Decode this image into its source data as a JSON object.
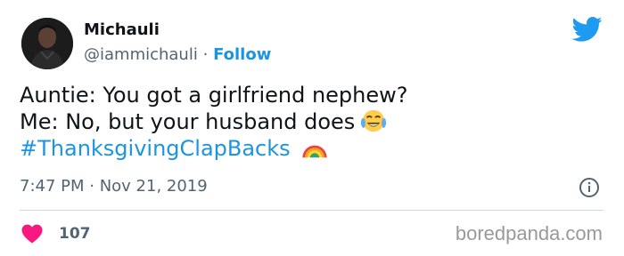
{
  "author": {
    "name": "Michauli",
    "handle": "@iammichauli",
    "separator": "·",
    "follow_label": "Follow"
  },
  "tweet": {
    "line1": "Auntie: You got a girlfriend nephew?",
    "line2": "Me: No, but your husband does",
    "hashtag": "#ThanksgivingClapBacks",
    "emoji_1": "face-with-tears-of-joy",
    "emoji_2": "rainbow"
  },
  "meta": {
    "timestamp": "7:47 PM · Nov 21, 2019"
  },
  "actions": {
    "like_count": "107"
  },
  "watermark": "boredpanda.com",
  "icons": {
    "brand": "twitter-bird-icon",
    "info": "info-icon",
    "like": "heart-icon"
  },
  "colors": {
    "link": "#1b95e0",
    "twitter_blue": "#1d9bf0",
    "heart": "#f91880",
    "muted": "#536471",
    "text": "#0f1419"
  }
}
